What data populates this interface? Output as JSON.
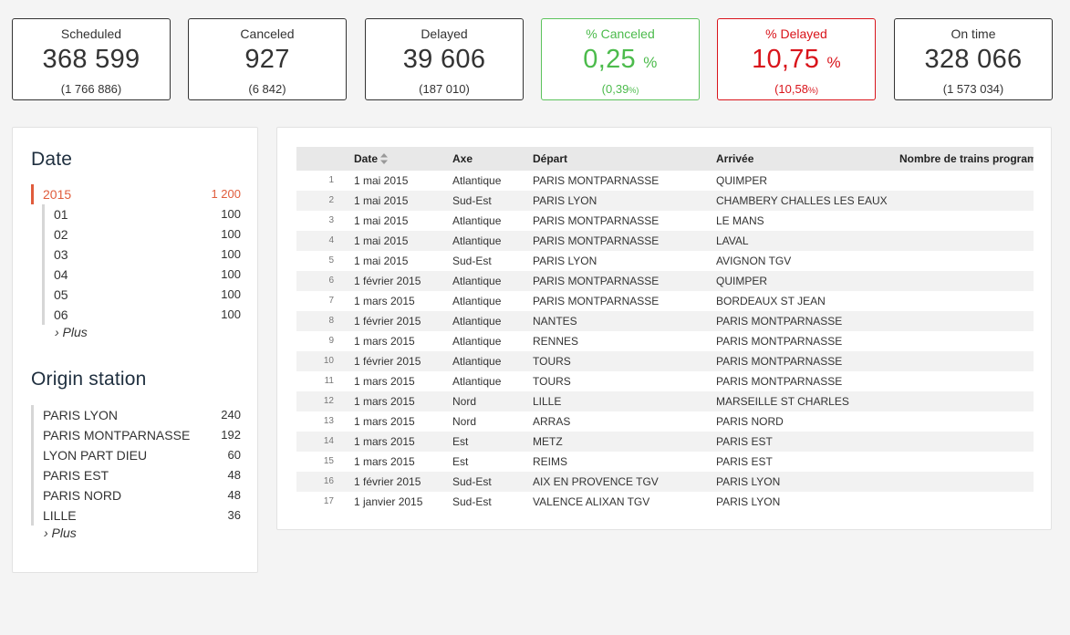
{
  "kpis": [
    {
      "label": "Scheduled",
      "value": "368 599",
      "value_unit": "",
      "sub": "(1 766 886)",
      "sub_unit": "",
      "tone": "normal"
    },
    {
      "label": "Canceled",
      "value": "927",
      "value_unit": "",
      "sub": "(6 842)",
      "sub_unit": "",
      "tone": "normal"
    },
    {
      "label": "Delayed",
      "value": "39 606",
      "value_unit": "",
      "sub": "(187 010)",
      "sub_unit": "",
      "tone": "normal"
    },
    {
      "label": "% Canceled",
      "value": "0,25",
      "value_unit": "%",
      "sub": "(0,39",
      "sub_unit": "%)",
      "tone": "green"
    },
    {
      "label": "% Delayed",
      "value": "10,75",
      "value_unit": "%",
      "sub": "(10,58",
      "sub_unit": "%)",
      "tone": "red"
    },
    {
      "label": "On time",
      "value": "328 066",
      "value_unit": "",
      "sub": "(1 573 034)",
      "sub_unit": "",
      "tone": "normal"
    }
  ],
  "colors": {
    "green": "#4cbb4c",
    "red": "#d9141b",
    "accent": "#e05c3c",
    "heading": "#1f2f3f"
  },
  "date_facet": {
    "title": "Date",
    "selected": {
      "label": "2015",
      "count": "1 200"
    },
    "items": [
      {
        "label": "01",
        "count": "100"
      },
      {
        "label": "02",
        "count": "100"
      },
      {
        "label": "03",
        "count": "100"
      },
      {
        "label": "04",
        "count": "100"
      },
      {
        "label": "05",
        "count": "100"
      },
      {
        "label": "06",
        "count": "100"
      }
    ],
    "more": "› Plus"
  },
  "origin_facet": {
    "title": "Origin station",
    "items": [
      {
        "label": "PARIS LYON",
        "count": "240"
      },
      {
        "label": "PARIS MONTPARNASSE",
        "count": "192"
      },
      {
        "label": "LYON PART DIEU",
        "count": "60"
      },
      {
        "label": "PARIS EST",
        "count": "48"
      },
      {
        "label": "PARIS NORD",
        "count": "48"
      },
      {
        "label": "LILLE",
        "count": "36"
      }
    ],
    "more": "› Plus"
  },
  "table": {
    "headers": {
      "date": "Date",
      "axe": "Axe",
      "depart": "Départ",
      "arrivee": "Arrivée",
      "nb": "Nombre de trains programmés"
    },
    "sort_icon": "sort-updown-icon",
    "rows": [
      {
        "idx": "1",
        "date": "1 mai 2015",
        "axe": "Atlantique",
        "depart": "PARIS MONTPARNASSE",
        "arrivee": "QUIMPER"
      },
      {
        "idx": "2",
        "date": "1 mai 2015",
        "axe": "Sud-Est",
        "depart": "PARIS LYON",
        "arrivee": "CHAMBERY CHALLES LES EAUX"
      },
      {
        "idx": "3",
        "date": "1 mai 2015",
        "axe": "Atlantique",
        "depart": "PARIS MONTPARNASSE",
        "arrivee": "LE MANS"
      },
      {
        "idx": "4",
        "date": "1 mai 2015",
        "axe": "Atlantique",
        "depart": "PARIS MONTPARNASSE",
        "arrivee": "LAVAL"
      },
      {
        "idx": "5",
        "date": "1 mai 2015",
        "axe": "Sud-Est",
        "depart": "PARIS LYON",
        "arrivee": "AVIGNON TGV"
      },
      {
        "idx": "6",
        "date": "1 février 2015",
        "axe": "Atlantique",
        "depart": "PARIS MONTPARNASSE",
        "arrivee": "QUIMPER"
      },
      {
        "idx": "7",
        "date": "1 mars 2015",
        "axe": "Atlantique",
        "depart": "PARIS MONTPARNASSE",
        "arrivee": "BORDEAUX ST JEAN"
      },
      {
        "idx": "8",
        "date": "1 février 2015",
        "axe": "Atlantique",
        "depart": "NANTES",
        "arrivee": "PARIS MONTPARNASSE"
      },
      {
        "idx": "9",
        "date": "1 mars 2015",
        "axe": "Atlantique",
        "depart": "RENNES",
        "arrivee": "PARIS MONTPARNASSE"
      },
      {
        "idx": "10",
        "date": "1 février 2015",
        "axe": "Atlantique",
        "depart": "TOURS",
        "arrivee": "PARIS MONTPARNASSE"
      },
      {
        "idx": "11",
        "date": "1 mars 2015",
        "axe": "Atlantique",
        "depart": "TOURS",
        "arrivee": "PARIS MONTPARNASSE"
      },
      {
        "idx": "12",
        "date": "1 mars 2015",
        "axe": "Nord",
        "depart": "LILLE",
        "arrivee": "MARSEILLE ST CHARLES"
      },
      {
        "idx": "13",
        "date": "1 mars 2015",
        "axe": "Nord",
        "depart": "ARRAS",
        "arrivee": "PARIS NORD"
      },
      {
        "idx": "14",
        "date": "1 mars 2015",
        "axe": "Est",
        "depart": "METZ",
        "arrivee": "PARIS EST"
      },
      {
        "idx": "15",
        "date": "1 mars 2015",
        "axe": "Est",
        "depart": "REIMS",
        "arrivee": "PARIS EST"
      },
      {
        "idx": "16",
        "date": "1 février 2015",
        "axe": "Sud-Est",
        "depart": "AIX EN PROVENCE TGV",
        "arrivee": "PARIS LYON"
      },
      {
        "idx": "17",
        "date": "1 janvier 2015",
        "axe": "Sud-Est",
        "depart": "VALENCE ALIXAN TGV",
        "arrivee": "PARIS LYON"
      }
    ]
  }
}
